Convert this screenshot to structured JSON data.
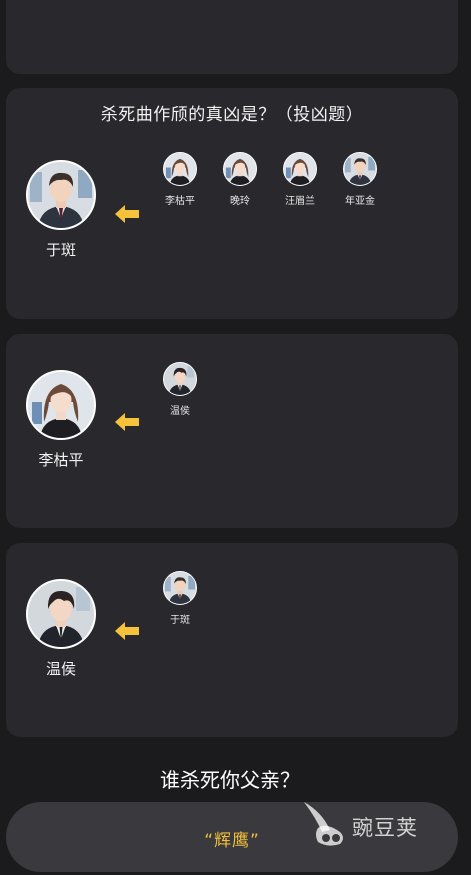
{
  "colors": {
    "background": "#1b1a1d",
    "card": "#29282d",
    "arrow": "#f5c23a",
    "answer_text": "#f2bf3a"
  },
  "q1": {
    "question": "杀死曲作颀的真凶是？（投凶题）",
    "suspect": "于斑",
    "voters": [
      "李枯平",
      "晚玲",
      "汪眉兰",
      "年亚金"
    ]
  },
  "q2": {
    "suspect": "李枯平",
    "voters": [
      "温侯"
    ]
  },
  "q3": {
    "suspect": "温侯",
    "voters": [
      "于斑"
    ]
  },
  "final": {
    "question": "谁杀死你父亲？",
    "answer": "“辉鹰”"
  },
  "watermark": {
    "text": "豌豆荚",
    "icon": "wandoujia-logo-icon"
  },
  "icons": {
    "arrow": "arrow-left-icon"
  }
}
